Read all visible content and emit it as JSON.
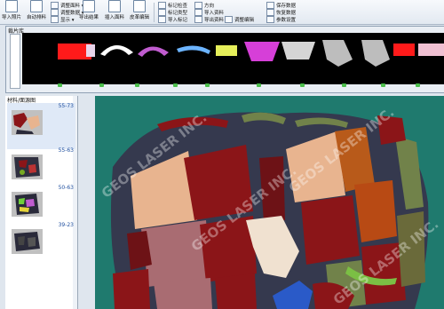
{
  "toolbar": {
    "buttons": [
      {
        "key": "import_file",
        "label": "导入照片",
        "icon": "file-import-icon"
      },
      {
        "key": "auto_material",
        "label": "自动排料",
        "icon": "auto-icon"
      },
      {
        "key": "export_result",
        "label": "导出结果",
        "icon": "export-icon"
      },
      {
        "key": "insert_material",
        "label": "插入面料",
        "icon": "insert-icon"
      },
      {
        "key": "fabric_edit",
        "label": "皮革编辑",
        "icon": "fabric-icon"
      }
    ],
    "small_items": [
      {
        "key": "adjust_material",
        "label": "调整面料 ▾"
      },
      {
        "key": "adjust_data",
        "label": "调整数据 ▾"
      },
      {
        "key": "show",
        "label": "显示 ▾"
      },
      {
        "key": "mark_check",
        "label": "标记检查"
      },
      {
        "key": "mark_type",
        "label": "标记类型"
      },
      {
        "key": "import_mark",
        "label": "导入标记"
      },
      {
        "key": "direction",
        "label": "方向"
      },
      {
        "key": "import_info",
        "label": "导入资料"
      },
      {
        "key": "export_info",
        "label": "导出资料"
      },
      {
        "key": "adjust_edit",
        "label": "调整编辑"
      },
      {
        "key": "save_data",
        "label": "保存数据"
      },
      {
        "key": "recover_data",
        "label": "恢复数据"
      },
      {
        "key": "params",
        "label": "参数设置"
      }
    ]
  },
  "pieces_panel": {
    "title": "裁片库"
  },
  "materials_panel": {
    "title": "材料/面源图",
    "items": [
      {
        "label": "55-73"
      },
      {
        "label": "55-63"
      },
      {
        "label": "50-63"
      },
      {
        "label": "39-23"
      }
    ]
  },
  "watermarks": [
    "GEOS LASER INC.",
    "GEOS LASER INC.",
    "GEOS LASER INC.",
    "GEOS LASER INC."
  ],
  "colors": {
    "canvas_bg": "#1f7a6e",
    "leather": "#35394e",
    "dark_red": "#8b1518",
    "tan": "#e8b48f",
    "light": "#f0e1d0",
    "olive": "#71824a",
    "pink": "#a96c72"
  }
}
